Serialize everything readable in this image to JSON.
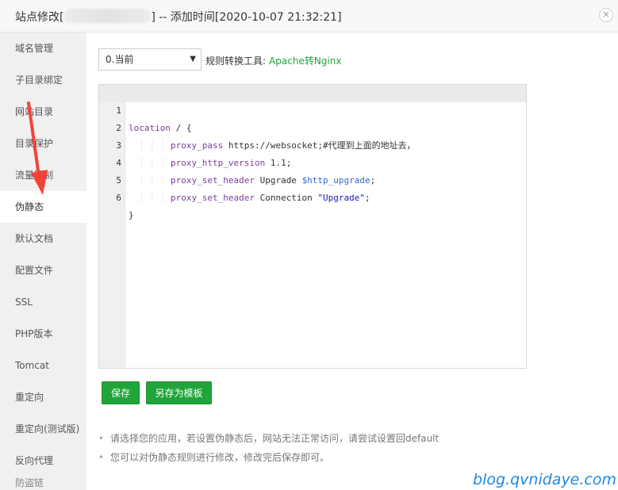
{
  "title": {
    "prefix": "站点修改[",
    "suffix": "] -- 添加时间[2020-10-07 21:32:21]"
  },
  "sidebar": {
    "items": [
      {
        "label": "域名管理"
      },
      {
        "label": "子目录绑定"
      },
      {
        "label": "网站目录"
      },
      {
        "label": "目录保护"
      },
      {
        "label": "流量限制"
      },
      {
        "label": "伪静态",
        "active": true
      },
      {
        "label": "默认文档"
      },
      {
        "label": "配置文件"
      },
      {
        "label": "SSL"
      },
      {
        "label": "PHP版本"
      },
      {
        "label": "Tomcat"
      },
      {
        "label": "重定向"
      },
      {
        "label": "重定向(测试版)"
      },
      {
        "label": "反向代理"
      },
      {
        "label": "防盗链"
      }
    ]
  },
  "rewrite": {
    "select_value": "0.当前",
    "tool_label": "规则转换工具:",
    "tool_link": "Apache转Nginx"
  },
  "editor": {
    "lines": [
      {
        "n": "1",
        "kw": "location",
        "rest": " / {"
      },
      {
        "n": "2",
        "kw": "proxy_pass",
        "rest": " https://websocket;#代理到上面的地址去，"
      },
      {
        "n": "3",
        "kw": "proxy_http_version",
        "rest": " 1.1;"
      },
      {
        "n": "4",
        "kw": "proxy_set_header",
        "rest": " Upgrade ",
        "var": "$http_upgrade",
        "tail": ";"
      },
      {
        "n": "5",
        "kw": "proxy_set_header",
        "rest": " Connection ",
        "str": "\"Upgrade\"",
        "tail": ";"
      },
      {
        "n": "6",
        "kw": "",
        "rest": "}"
      }
    ]
  },
  "buttons": {
    "save": "保存",
    "save_template": "另存为模板"
  },
  "tips": [
    "请选择您的应用，若设置伪静态后，网站无法正常访问，请尝试设置回default",
    "您可以对伪静态规则进行修改，修改完后保存即可。"
  ],
  "watermark": "blog.qvnidaye.com",
  "colors": {
    "accent": "#20a53a",
    "annotation_arrow": "#f44336"
  },
  "icons": {
    "close": "close-icon",
    "dropdown": "caret-down-icon"
  }
}
